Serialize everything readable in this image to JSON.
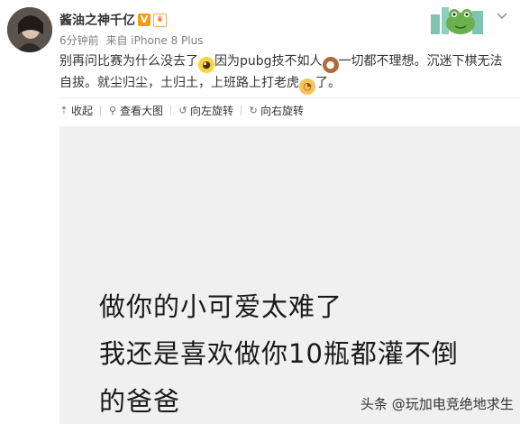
{
  "post": {
    "username": "酱油之神千亿",
    "verified_badge": "V",
    "vip_badge": "♛",
    "time": "6分钟前",
    "source": "来自 iPhone 8 Plus",
    "text_part1": "别再问比赛为什么没去了",
    "text_part2": "因为pubg技不如人",
    "text_part3": "一切都不理想。沉迷下棋无法自拔。就尘归尘，土归土，上班路上打老虎",
    "text_part4": "了。",
    "emojis": [
      "laughing-emoji",
      "monkey-emoji",
      "tiger-emoji"
    ]
  },
  "toolbar": {
    "collapse": "收起",
    "view_large": "查看大图",
    "rotate_left": "向左旋转",
    "rotate_right": "向右旋转"
  },
  "image": {
    "line1": "做你的小可爱太难了",
    "line2": "我还是喜欢做你10瓶都灌不倒",
    "line3": "的爸爸"
  },
  "watermark": "头条 @玩加电竞绝地求生",
  "colors": {
    "badge_orange": "#f59b12",
    "image_bg": "#f0f0f0",
    "meta_gray": "#808080"
  }
}
